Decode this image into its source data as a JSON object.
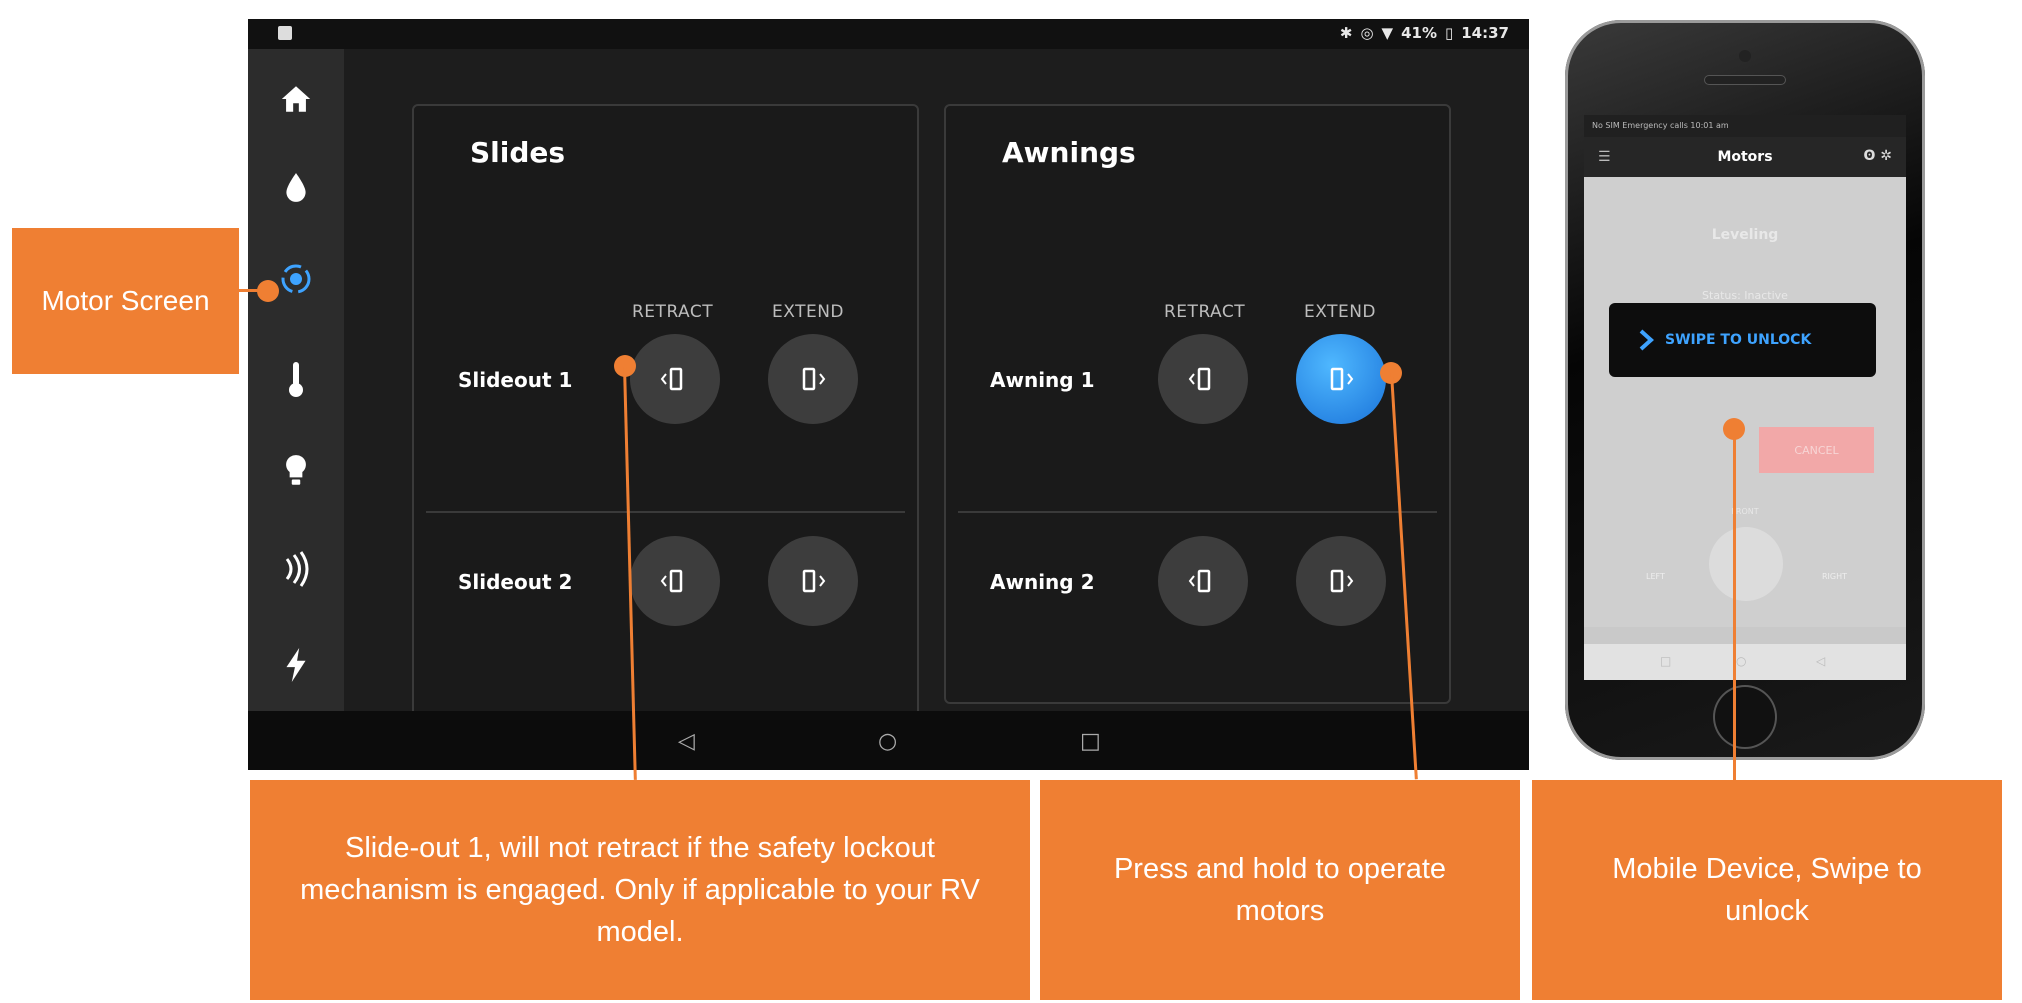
{
  "tablet": {
    "status_bar": {
      "battery": "41%",
      "time": "14:37"
    },
    "sidebar": {
      "items": [
        {
          "name": "home-icon",
          "glyph": "🏠"
        },
        {
          "name": "water-drop-icon",
          "glyph": "💧"
        },
        {
          "name": "motor-icon",
          "glyph": "⚙"
        },
        {
          "name": "thermometer-icon",
          "glyph": "🌡"
        },
        {
          "name": "light-bulb-icon",
          "glyph": "💡"
        },
        {
          "name": "signal-icon",
          "glyph": ")))"
        },
        {
          "name": "power-icon",
          "glyph": "⚡"
        }
      ]
    },
    "slides": {
      "title": "Slides",
      "retract_label": "RETRACT",
      "extend_label": "EXTEND",
      "rows": [
        {
          "label": "Slideout 1"
        },
        {
          "label": "Slideout 2"
        }
      ]
    },
    "awnings": {
      "title": "Awnings",
      "retract_label": "RETRACT",
      "extend_label": "EXTEND",
      "rows": [
        {
          "label": "Awning 1",
          "extend_active": true
        },
        {
          "label": "Awning 2"
        }
      ]
    }
  },
  "phone": {
    "status_left": "No SIM Emergency calls  10:01 am",
    "header_title": "Motors",
    "section_title": "Leveling",
    "status_text": "Status: Inactive",
    "lock_label": "SWIPE TO UNLOCK",
    "cancel_label": "CANCEL",
    "front_label": "FRONT",
    "left_label": "LEFT",
    "right_label": "RIGHT"
  },
  "callouts": {
    "motor_screen": "Motor Screen",
    "slideout": "Slide-out 1, will not retract if the safety lockout mechanism is engaged.  Only if applicable to your RV model.",
    "press_hold": "Press and hold to operate motors",
    "mobile": "Mobile Device, Swipe to unlock"
  },
  "colors": {
    "accent_orange": "#ef7f33",
    "active_blue": "#1a73d9"
  }
}
